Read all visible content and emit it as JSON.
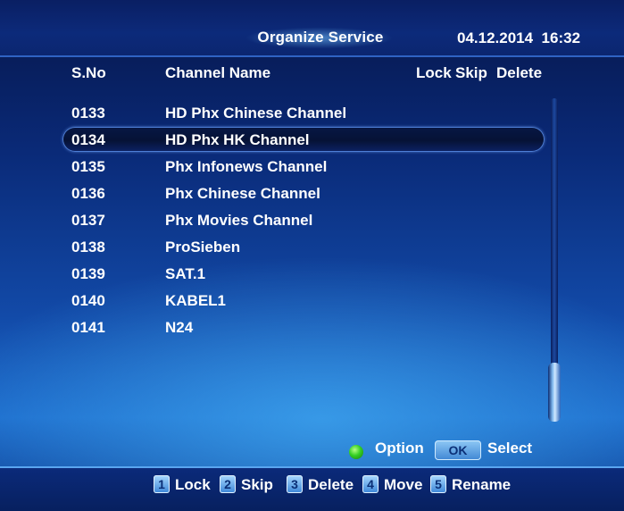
{
  "header": {
    "title": "Organize Service",
    "date": "04.12.2014",
    "time": "16:32"
  },
  "columns": {
    "sno": "S.No",
    "channel_name": "Channel Name",
    "lock": "Lock",
    "skip": "Skip",
    "delete": "Delete"
  },
  "channels": [
    {
      "no": "0133",
      "name": "HD Phx Chinese Channel"
    },
    {
      "no": "0134",
      "name": "HD Phx HK Channel",
      "selected": true
    },
    {
      "no": "0135",
      "name": "Phx Infonews Channel"
    },
    {
      "no": "0136",
      "name": "Phx Chinese Channel"
    },
    {
      "no": "0137",
      "name": "Phx Movies Channel"
    },
    {
      "no": "0138",
      "name": "ProSieben"
    },
    {
      "no": "0139",
      "name": "SAT.1"
    },
    {
      "no": "0140",
      "name": "KABEL1"
    },
    {
      "no": "0141",
      "name": "N24"
    }
  ],
  "hints": {
    "option": "Option",
    "ok": "OK",
    "select": "Select"
  },
  "keys": [
    {
      "num": "1",
      "label": "Lock"
    },
    {
      "num": "2",
      "label": "Skip"
    },
    {
      "num": "3",
      "label": "Delete"
    },
    {
      "num": "4",
      "label": "Move"
    },
    {
      "num": "5",
      "label": "Rename"
    }
  ],
  "colors": {
    "background": "#124aa8",
    "selection": "#061235",
    "option_button": "#34d024",
    "key_badge": "#3b86d8"
  },
  "icons": {
    "option": "green-circle-button-icon"
  }
}
